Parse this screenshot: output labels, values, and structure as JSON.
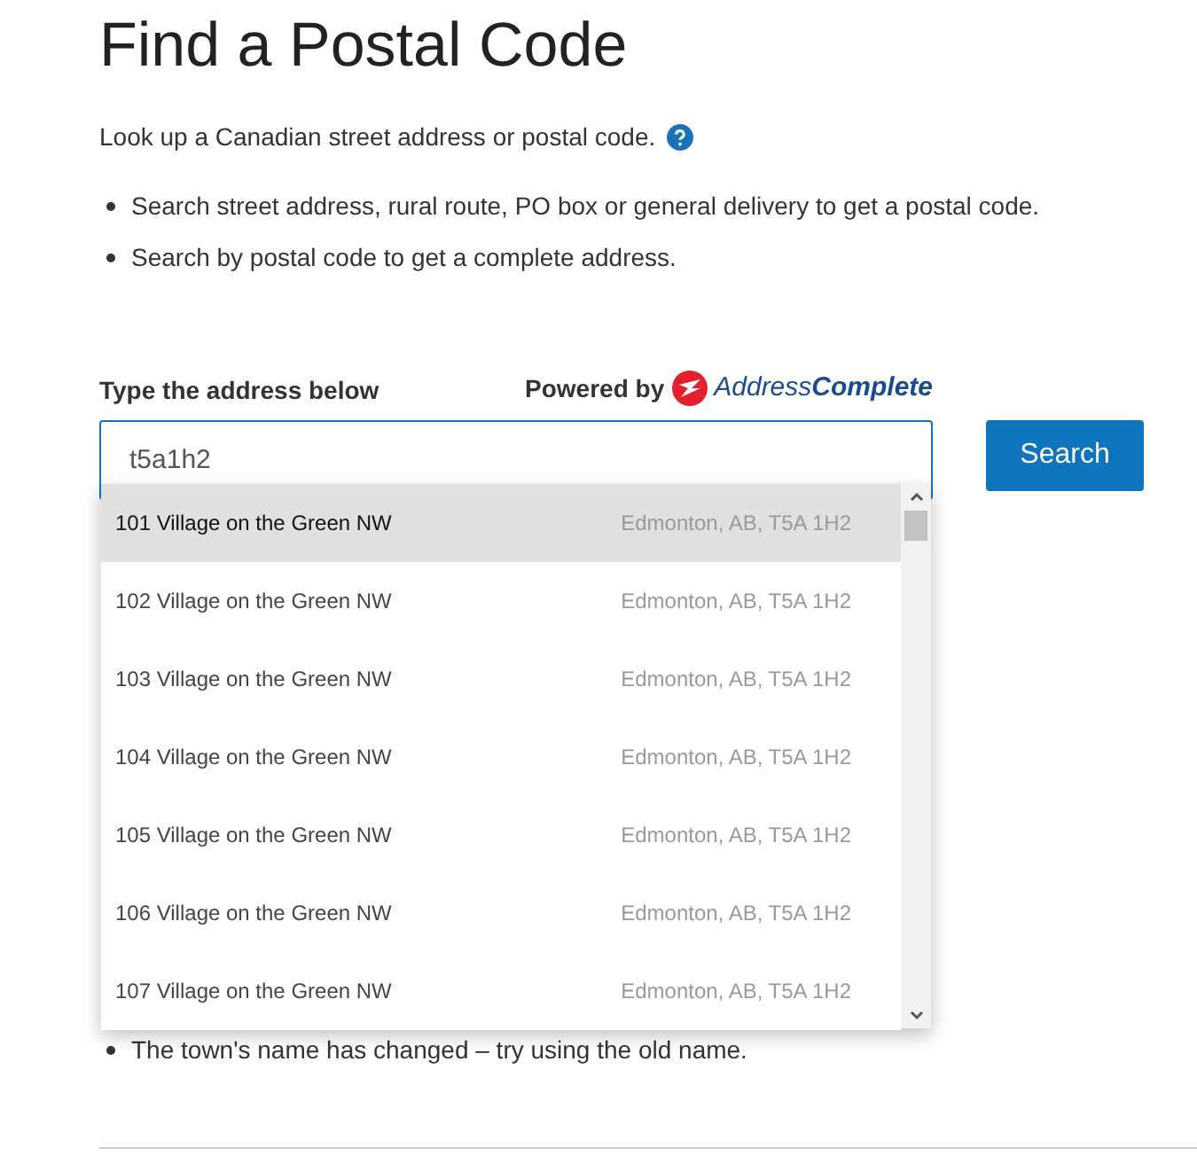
{
  "title": "Find a Postal Code",
  "intro": "Look up a Canadian street address or postal code.",
  "bullets": [
    "Search street address, rural route, PO box or general delivery to get a postal code.",
    "Search by postal code to get a complete address."
  ],
  "field_label": "Type the address below",
  "powered_by": {
    "text": "Powered by",
    "brand_light": "Address",
    "brand_bold": "Complete"
  },
  "search": {
    "value": "t5a1h2",
    "button": "Search"
  },
  "suggestions": [
    {
      "address": "101 Village on the Green NW",
      "place": "Edmonton, AB, T5A 1H2",
      "selected": true
    },
    {
      "address": "102 Village on the Green NW",
      "place": "Edmonton, AB, T5A 1H2",
      "selected": false
    },
    {
      "address": "103 Village on the Green NW",
      "place": "Edmonton, AB, T5A 1H2",
      "selected": false
    },
    {
      "address": "104 Village on the Green NW",
      "place": "Edmonton, AB, T5A 1H2",
      "selected": false
    },
    {
      "address": "105 Village on the Green NW",
      "place": "Edmonton, AB, T5A 1H2",
      "selected": false
    },
    {
      "address": "106 Village on the Green NW",
      "place": "Edmonton, AB, T5A 1H2",
      "selected": false
    },
    {
      "address": "107 Village on the Green NW",
      "place": "Edmonton, AB, T5A 1H2",
      "selected": false
    }
  ],
  "tips": [
    "The town's name has changed – try using the old name."
  ]
}
